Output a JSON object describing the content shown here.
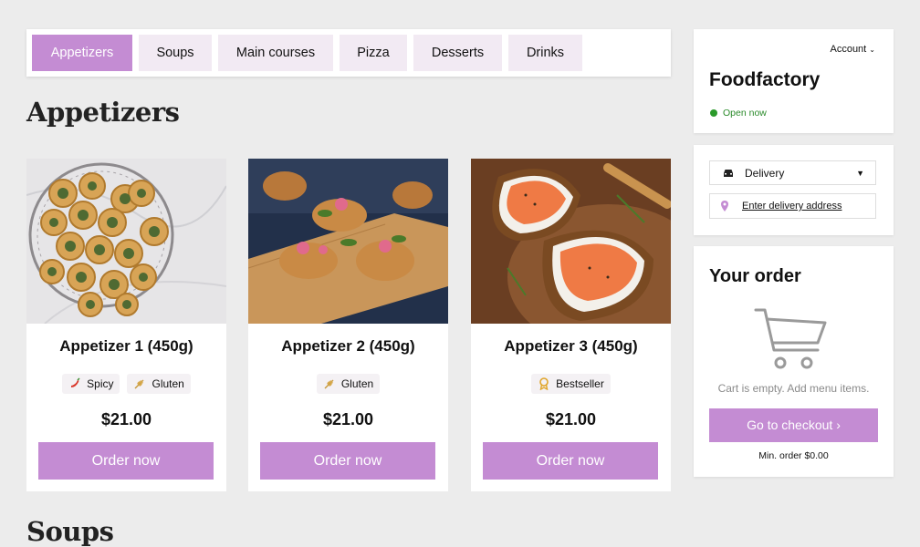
{
  "nav": {
    "tabs": [
      {
        "label": "Appetizers",
        "active": true
      },
      {
        "label": "Soups",
        "active": false
      },
      {
        "label": "Main courses",
        "active": false
      },
      {
        "label": "Pizza",
        "active": false
      },
      {
        "label": "Desserts",
        "active": false
      },
      {
        "label": "Drinks",
        "active": false
      }
    ]
  },
  "sections": [
    {
      "title": "Appetizers"
    },
    {
      "title": "Soups"
    }
  ],
  "products": [
    {
      "name": "Appetizer 1 (450g)",
      "tags": [
        {
          "label": "Spicy",
          "icon": "chili-icon"
        },
        {
          "label": "Gluten",
          "icon": "wheat-icon"
        }
      ],
      "price": "$21.00",
      "button": "Order now",
      "image": "pinwheel-pastries-photo"
    },
    {
      "name": "Appetizer 2 (450g)",
      "tags": [
        {
          "label": "Gluten",
          "icon": "wheat-icon"
        }
      ],
      "price": "$21.00",
      "button": "Order now",
      "image": "galettes-photo"
    },
    {
      "name": "Appetizer 3 (450g)",
      "tags": [
        {
          "label": "Bestseller",
          "icon": "award-icon"
        }
      ],
      "price": "$21.00",
      "button": "Order now",
      "image": "salmon-toast-photo"
    }
  ],
  "sidebar": {
    "account_label": "Account",
    "brand": "Foodfactory",
    "status": "Open now",
    "delivery": {
      "mode": "Delivery",
      "address_placeholder": "Enter delivery address"
    },
    "order": {
      "title": "Your order",
      "empty_text": "Cart is empty. Add menu items.",
      "checkout_label": "Go to checkout",
      "min_order": "Min. order $0.00"
    }
  },
  "colors": {
    "accent": "#c48cd3",
    "tab_bg": "#f2eaf3",
    "open_status": "#2a8a2a",
    "page_bg": "#ececec"
  }
}
